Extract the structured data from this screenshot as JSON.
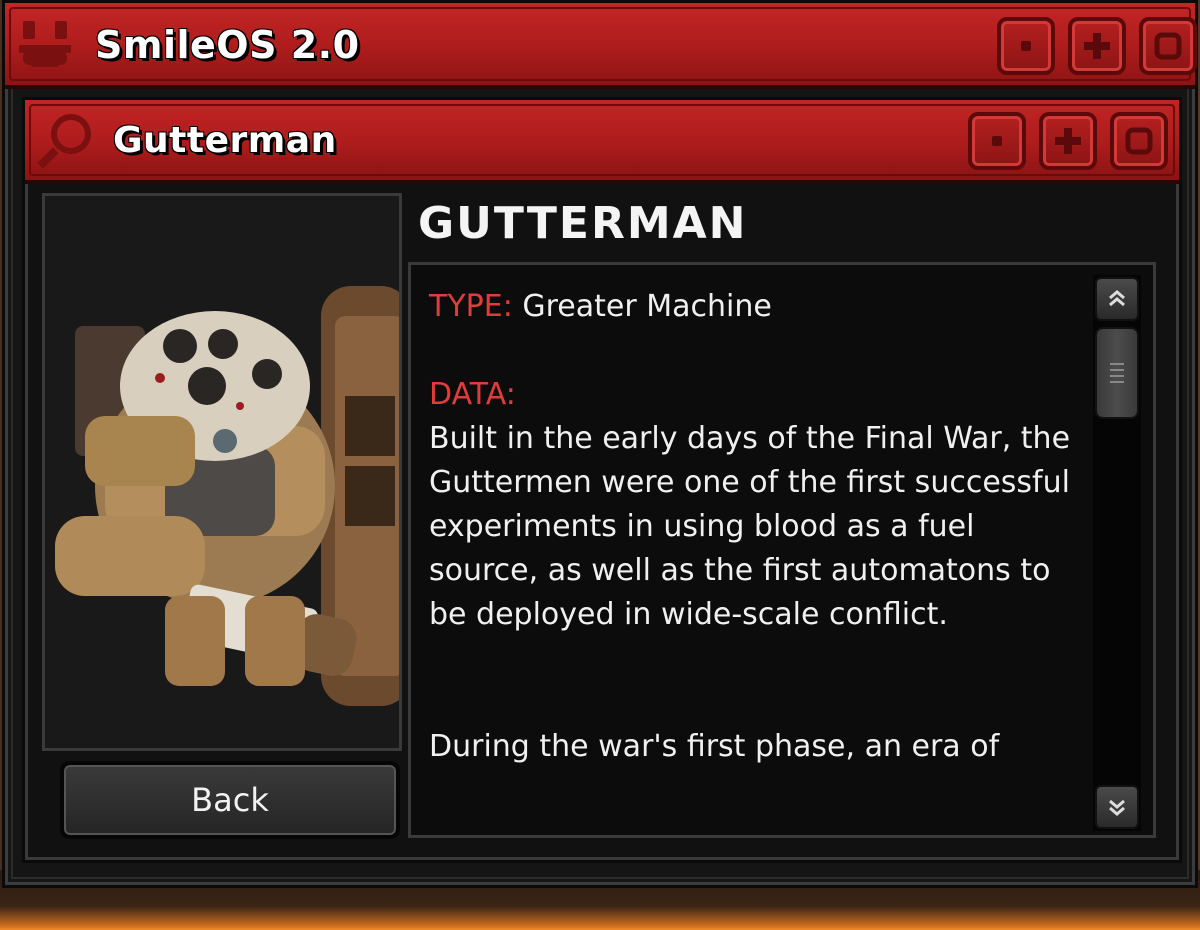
{
  "os": {
    "title": "SmileOS 2.0",
    "controls": [
      "minimize",
      "maximize",
      "restore"
    ]
  },
  "app": {
    "title": "Gutterman",
    "controls": [
      "minimize",
      "maximize",
      "restore"
    ]
  },
  "entry": {
    "heading": "GUTTERMAN",
    "type_label": "TYPE:",
    "type_value": "Greater Machine",
    "data_label": "DATA:",
    "paragraph1": "Built in the early days of the Final War, the Guttermen were one of the first successful experiments in using blood as a fuel source, as well as the first automatons to be deployed in wide-scale conflict.",
    "paragraph2": "During the war's first phase, an era of"
  },
  "buttons": {
    "back": "Back"
  },
  "colors": {
    "titlebar_red": "#b01d1d",
    "label_red": "#e23b3b",
    "panel_bg": "#0c0c0c"
  }
}
